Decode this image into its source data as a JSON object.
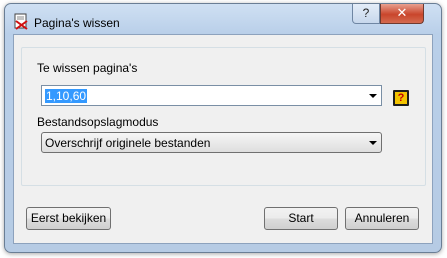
{
  "window": {
    "title": "Pagina's wissen",
    "help_button": "?",
    "close_button": "✕"
  },
  "pages": {
    "label": "Te wissen pagina's",
    "value": "1,10,60",
    "help_icon": "?"
  },
  "storage_mode": {
    "label": "Bestandsopslagmodus",
    "selected": "Overschrijf originele bestanden"
  },
  "buttons": {
    "preview": "Eerst bekijken",
    "start": "Start",
    "cancel": "Annuleren"
  },
  "icons": {
    "app": "delete-pages-icon",
    "help": "help-question-icon",
    "dropdown": "chevron-down-icon"
  },
  "colors": {
    "selection": "#3399ff",
    "close_button": "#c9462c",
    "help_icon_bg": "#f3c300",
    "help_icon_fg": "#c00000"
  }
}
